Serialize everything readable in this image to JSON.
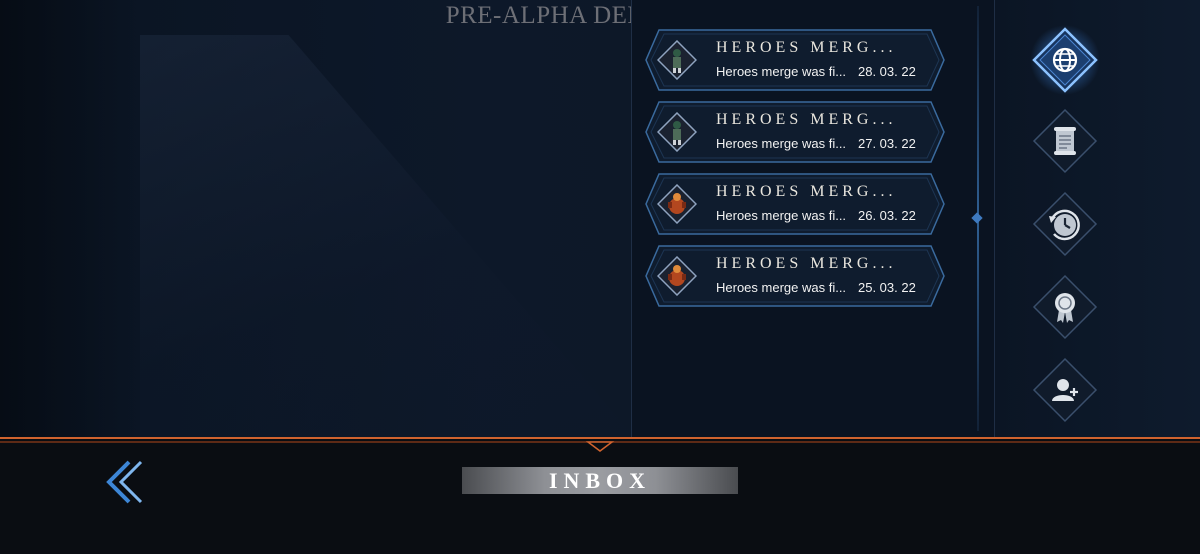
{
  "build_banner": "PRE-ALPHA DEMO BUILD",
  "screen_title": "INBOX",
  "colors": {
    "accent_blue": "#3e7ac0",
    "accent_orange": "#d0632e",
    "panel_bg": "#0a1321"
  },
  "messages": [
    {
      "title": "HEROES MERG...",
      "preview": "Heroes merge was fi...",
      "date": "28. 03. 22",
      "avatar": "green-hero-avatar-icon"
    },
    {
      "title": "HEROES MERG...",
      "preview": "Heroes merge was fi...",
      "date": "27. 03. 22",
      "avatar": "green-hero-avatar-icon"
    },
    {
      "title": "HEROES MERG...",
      "preview": "Heroes merge was fi...",
      "date": "26. 03. 22",
      "avatar": "fire-hero-avatar-icon"
    },
    {
      "title": "HEROES MERG...",
      "preview": "Heroes merge was fi...",
      "date": "25. 03. 22",
      "avatar": "fire-hero-avatar-icon"
    }
  ],
  "side_tabs": [
    {
      "name": "globe-tab",
      "icon": "globe-icon",
      "active": true
    },
    {
      "name": "scroll-tab",
      "icon": "scroll-icon",
      "active": false
    },
    {
      "name": "history-tab",
      "icon": "clock-refresh-icon",
      "active": false
    },
    {
      "name": "award-tab",
      "icon": "medal-icon",
      "active": false
    },
    {
      "name": "add-friend-tab",
      "icon": "add-user-icon",
      "active": false
    }
  ],
  "back_icon": "chevron-left-icon"
}
